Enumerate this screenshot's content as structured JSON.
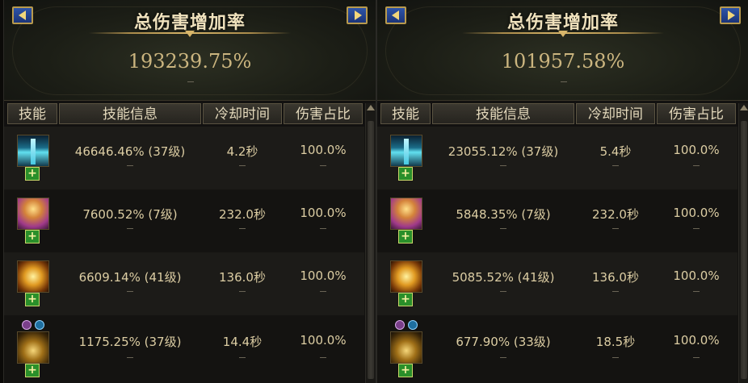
{
  "panels": [
    {
      "title": "总伤害增加率",
      "total": "193239.75%",
      "headers": {
        "skill": "技能",
        "info": "技能信息",
        "cooldown": "冷却时间",
        "ratio": "伤害占比"
      },
      "rows": [
        {
          "icon": "sword-skill-icon",
          "info": "46646.46% (37级)",
          "cooldown": "4.2秒",
          "ratio": "100.0%"
        },
        {
          "icon": "angel-skill-icon",
          "info": "7600.52% (7级)",
          "cooldown": "232.0秒",
          "ratio": "100.0%"
        },
        {
          "icon": "gold-burst-skill-icon",
          "info": "6609.14% (41级)",
          "cooldown": "136.0秒",
          "ratio": "100.0%"
        },
        {
          "icon": "rune-skill-icon",
          "info": "1175.25% (37级)",
          "cooldown": "14.4秒",
          "ratio": "100.0%"
        }
      ]
    },
    {
      "title": "总伤害增加率",
      "total": "101957.58%",
      "headers": {
        "skill": "技能",
        "info": "技能信息",
        "cooldown": "冷却时间",
        "ratio": "伤害占比"
      },
      "rows": [
        {
          "icon": "sword-skill-icon",
          "info": "23055.12% (37级)",
          "cooldown": "5.4秒",
          "ratio": "100.0%"
        },
        {
          "icon": "angel-skill-icon",
          "info": "5848.35% (7级)",
          "cooldown": "232.0秒",
          "ratio": "100.0%"
        },
        {
          "icon": "gold-burst-skill-icon",
          "info": "5085.52% (41级)",
          "cooldown": "136.0秒",
          "ratio": "100.0%"
        },
        {
          "icon": "rune-skill-icon",
          "info": "677.90% (33级)",
          "cooldown": "18.5秒",
          "ratio": "100.0%"
        }
      ]
    }
  ],
  "badge_symbol": "+"
}
